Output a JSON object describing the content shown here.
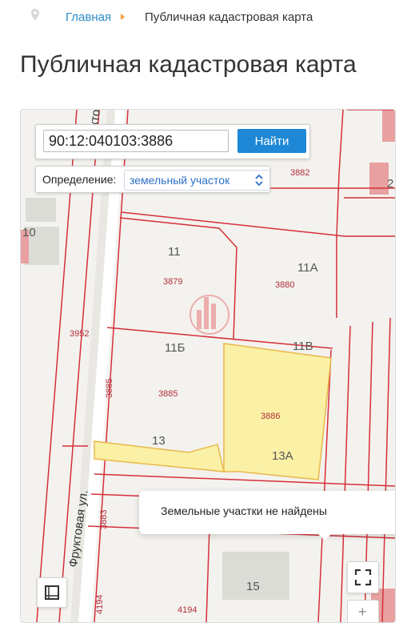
{
  "breadcrumb": {
    "home": "Главная",
    "current": "Публичная кадастровая карта"
  },
  "page_title": "Публичная кадастровая карта",
  "search": {
    "value": "90:12:040103:3886",
    "button": "Найти"
  },
  "definition": {
    "label": "Определение:",
    "value": "земельный участок"
  },
  "toast": {
    "message": "Земельные участки не найдены"
  },
  "map": {
    "street_label": "Фруктовая ул.",
    "street_label_partial": "кто",
    "selected_parcel": "3886",
    "parcel_numbers": [
      "3882",
      "3879",
      "3880",
      "3952",
      "3885",
      "3883",
      "4194",
      "4194"
    ],
    "house_numbers": [
      "11",
      "11А",
      "11Б",
      "11В",
      "13",
      "13А",
      "15",
      "10",
      "2"
    ],
    "colors": {
      "boundary": "#d4303a",
      "selected_fill": "#fbf1a6",
      "selected_stroke": "#e8b84a",
      "building": "#dcdcd6",
      "red_building": "#e8a0a0",
      "accent": "#1e88d6"
    }
  },
  "icons": {
    "pin": "map-pin-icon",
    "separator": "chevron-right-icon",
    "select": "chevron-updown-icon",
    "fullscreen": "fullscreen-icon",
    "layers": "layers-icon",
    "zoom": "plus-icon"
  }
}
